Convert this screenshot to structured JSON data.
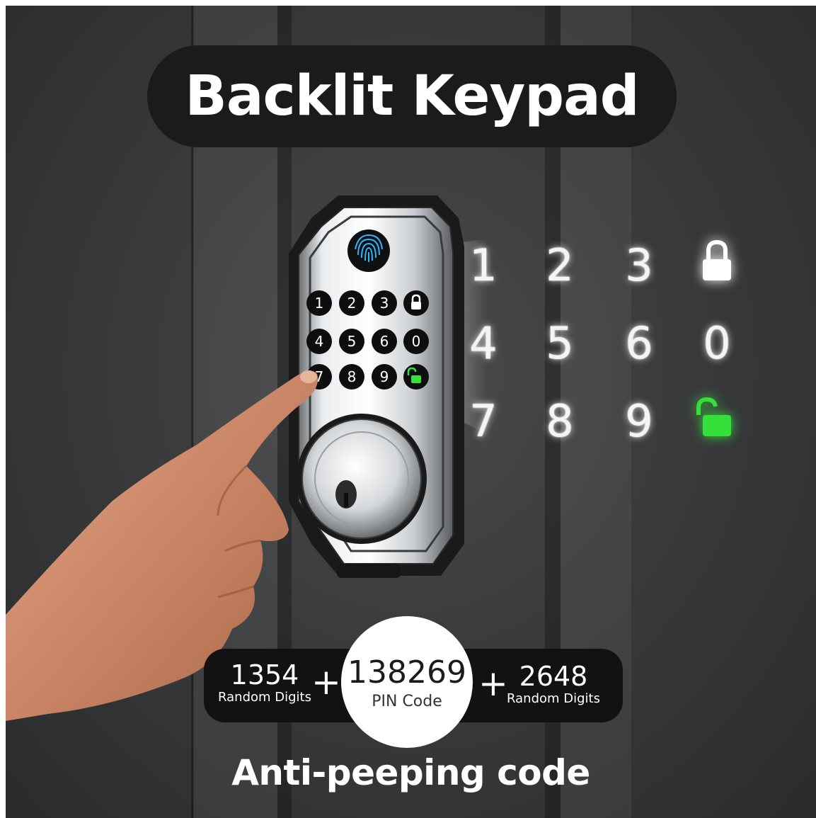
{
  "title": "Backlit Keypad",
  "keypad": {
    "device_keys": [
      "1",
      "2",
      "3",
      "lock",
      "4",
      "5",
      "6",
      "0",
      "7",
      "8",
      "9",
      "unlock"
    ],
    "display_rows": [
      [
        "1",
        "2",
        "3"
      ],
      [
        "4",
        "5",
        "6",
        "0"
      ],
      [
        "7",
        "8",
        "9"
      ]
    ],
    "lock_icon": "lock-icon",
    "unlock_icon": "unlock-icon",
    "fingerprint_icon": "fingerprint-icon",
    "unlock_color": "#35e03a"
  },
  "code": {
    "left_digits": "1354",
    "left_label": "Random Digits",
    "pin": "138269",
    "pin_label": "PIN Code",
    "right_digits": "2648",
    "right_label": "Random Digits",
    "plus": "+"
  },
  "footer": "Anti-peeping code"
}
